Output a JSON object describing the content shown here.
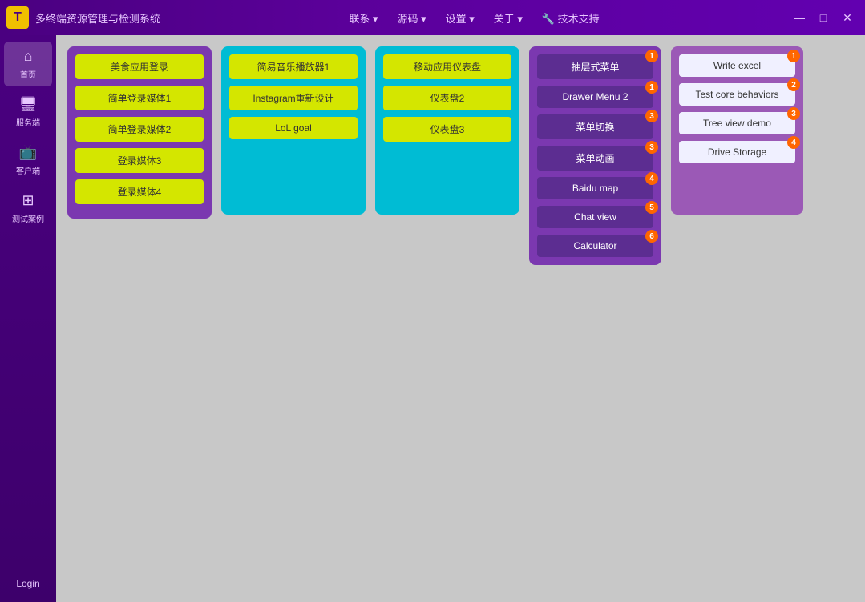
{
  "titlebar": {
    "logo": "T",
    "title": "多终端资源管理与检测系统",
    "menus": [
      {
        "label": "联系 ▾"
      },
      {
        "label": "源码 ▾"
      },
      {
        "label": "设置 ▾"
      },
      {
        "label": "关于 ▾"
      },
      {
        "label": "🔧 技术支持"
      }
    ],
    "win_controls": [
      "—",
      "□",
      "✕"
    ]
  },
  "sidebar": {
    "items": [
      {
        "label": "首页",
        "icon": "⌂"
      },
      {
        "label": "服务端",
        "icon": "🖥"
      },
      {
        "label": "客户端",
        "icon": "📺"
      },
      {
        "label": "测试案例",
        "icon": "⊞"
      }
    ],
    "login": "Login"
  },
  "panels": {
    "panel1": {
      "buttons": [
        {
          "label": "美食应用登录",
          "style": "lime"
        },
        {
          "label": "简单登录媒体1",
          "style": "lime"
        },
        {
          "label": "简单登录媒体2",
          "style": "lime"
        },
        {
          "label": "登录媒体3",
          "style": "lime"
        },
        {
          "label": "登录媒体4",
          "style": "lime"
        }
      ]
    },
    "panel2": {
      "buttons": [
        {
          "label": "简易音乐播放器1",
          "style": "lime"
        },
        {
          "label": "Instagram重新设计",
          "style": "lime"
        },
        {
          "label": "LoL goal",
          "style": "lime"
        }
      ]
    },
    "panel3": {
      "buttons": [
        {
          "label": "移动应用仪表盘",
          "style": "lime"
        },
        {
          "label": "仪表盘2",
          "style": "lime"
        },
        {
          "label": "仪表盘3",
          "style": "lime"
        }
      ]
    },
    "panel4": {
      "buttons": [
        {
          "label": "抽层式菜单",
          "style": "dark",
          "badge": "1"
        },
        {
          "label": "Drawer Menu 2",
          "style": "dark",
          "badge": "1"
        },
        {
          "label": "菜单切换",
          "style": "dark",
          "badge": "3"
        },
        {
          "label": "菜单动画",
          "style": "dark",
          "badge": "3"
        },
        {
          "label": "Baidu map",
          "style": "dark",
          "badge": "4"
        },
        {
          "label": "Chat view",
          "style": "dark",
          "badge": "5"
        },
        {
          "label": "Calculator",
          "style": "dark",
          "badge": "6"
        }
      ]
    },
    "panel5": {
      "buttons": [
        {
          "label": "Write excel",
          "style": "white",
          "badge": "1"
        },
        {
          "label": "Test core behaviors",
          "style": "white",
          "badge": "2"
        },
        {
          "label": "Tree view demo",
          "style": "white",
          "badge": "3"
        },
        {
          "label": "Drive Storage",
          "style": "white",
          "badge": "4"
        }
      ]
    }
  }
}
